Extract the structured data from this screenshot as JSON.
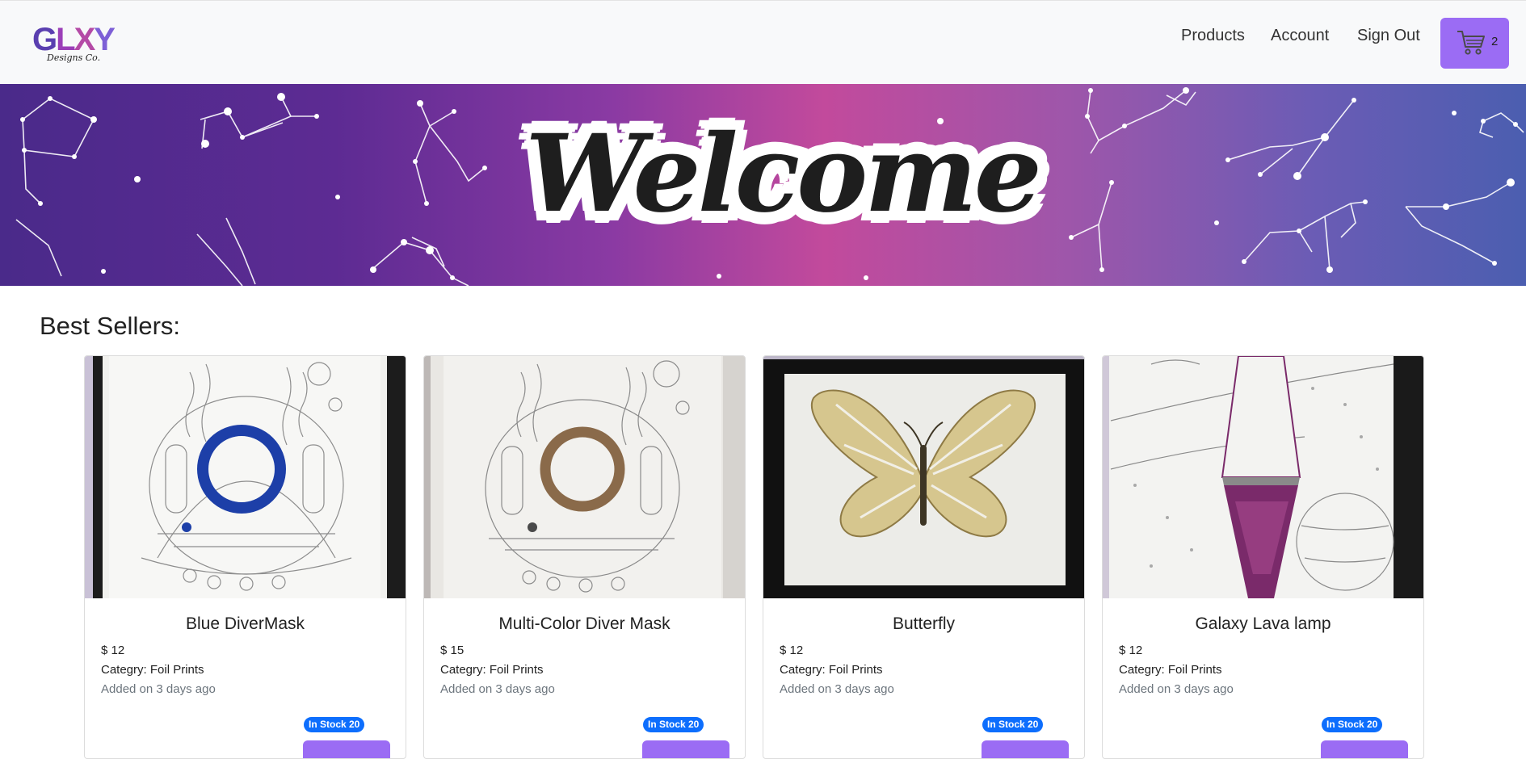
{
  "navbar": {
    "logo": {
      "main": "GLXY",
      "sub": "Designs Co."
    },
    "links": [
      {
        "label": "Products"
      },
      {
        "label": "Account"
      },
      {
        "label": "Sign Out"
      }
    ],
    "cart": {
      "count": "2",
      "icon": "cart-icon"
    }
  },
  "banner": {
    "text": "Welcome"
  },
  "section": {
    "title": "Best Sellers:"
  },
  "products": [
    {
      "title": "Blue DiverMask",
      "price": "$ 12",
      "category": "Categry: Foil Prints",
      "added": "Added on 3 days ago",
      "badge": "In Stock 20",
      "accent": "#1d3fa8"
    },
    {
      "title": "Multi-Color Diver Mask",
      "price": "$ 15",
      "category": "Categry: Foil Prints",
      "added": "Added on 3 days ago",
      "badge": "In Stock 20",
      "accent": "#8a6a4a"
    },
    {
      "title": "Butterfly",
      "price": "$ 12",
      "category": "Categry: Foil Prints",
      "added": "Added on 3 days ago",
      "badge": "In Stock 20",
      "accent": "#c9b57a"
    },
    {
      "title": "Galaxy Lava lamp",
      "price": "$ 12",
      "category": "Categry: Foil Prints",
      "added": "Added on 3 days ago",
      "badge": "In Stock 20",
      "accent": "#7a2a6a"
    }
  ],
  "colors": {
    "accent": "#9b6cf4",
    "badge": "#0d6efd",
    "navbar": "#f8f9fa"
  }
}
